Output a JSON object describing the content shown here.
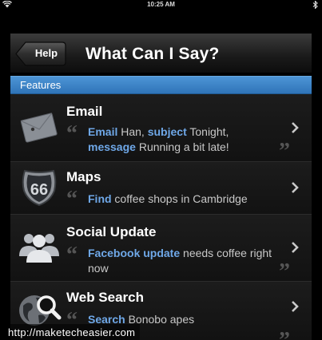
{
  "status_bar": {
    "time": "10:25 AM"
  },
  "navbar": {
    "back_label": "Help",
    "title": "What Can I Say?"
  },
  "section": {
    "label": "Features"
  },
  "rows": [
    {
      "title": "Email",
      "icon": "envelope-icon",
      "example": [
        {
          "text": "Email",
          "kw": true
        },
        {
          "text": " Han, ",
          "kw": false
        },
        {
          "text": "subject",
          "kw": true
        },
        {
          "text": " Tonight, ",
          "kw": false
        },
        {
          "text": "message",
          "kw": true
        },
        {
          "text": " Running a bit late!",
          "kw": false
        }
      ]
    },
    {
      "title": "Maps",
      "icon": "route-66-shield-icon",
      "shield_text": "66",
      "example": [
        {
          "text": "Find",
          "kw": true
        },
        {
          "text": " coffee shops in Cambridge",
          "kw": false
        }
      ]
    },
    {
      "title": "Social Update",
      "icon": "people-icon",
      "example": [
        {
          "text": "Facebook update",
          "kw": true
        },
        {
          "text": " needs coffee right now",
          "kw": false
        }
      ]
    },
    {
      "title": "Web Search",
      "icon": "globe-magnifier-icon",
      "example": [
        {
          "text": "Search",
          "kw": true
        },
        {
          "text": " Bonobo apes",
          "kw": false
        }
      ]
    }
  ],
  "quote_open": "“",
  "quote_close": "”",
  "watermark": "http://maketecheasier.com",
  "colors": {
    "section_blue": "#3b82c4",
    "keyword_blue": "#6fa8e8"
  }
}
